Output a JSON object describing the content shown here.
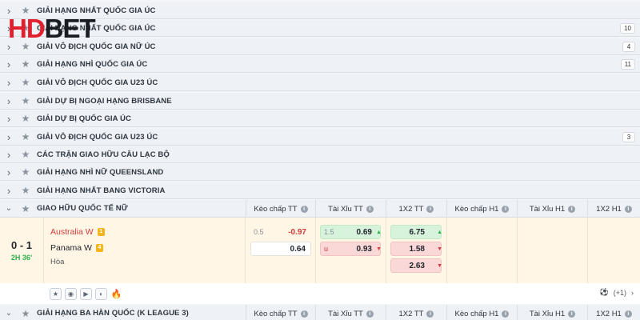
{
  "logo": {
    "part1": "HD",
    "part2": "BET"
  },
  "leagues": [
    {
      "name": "GIẢI HẠNG NHẤT QUỐC GIA ÚC",
      "count": ""
    },
    {
      "name": "GIẢI HẠNG NHẤT QUỐC GIA ÚC",
      "count": "10"
    },
    {
      "name": "GIẢI VÔ ĐỊCH QUỐC GIA NỮ ÚC",
      "count": "4"
    },
    {
      "name": "GIẢI HẠNG NHÌ QUỐC GIA ÚC",
      "count": "11"
    },
    {
      "name": "GIẢI VÔ ĐỊCH QUỐC GIA U23 ÚC",
      "count": ""
    },
    {
      "name": "GIẢI DỰ BỊ NGOẠI HẠNG BRISBANE",
      "count": ""
    },
    {
      "name": "GIẢI DỰ BỊ QUỐC GIA ÚC",
      "count": ""
    },
    {
      "name": "GIẢI VÔ ĐỊCH QUỐC GIA U23 ÚC",
      "count": "3"
    },
    {
      "name": "CÁC TRẬN GIAO HỮU CÂU LẠC BỘ",
      "count": ""
    },
    {
      "name": "GIẢI HẠNG NHÌ NỮ QUEENSLAND",
      "count": ""
    },
    {
      "name": "GIẢI HẠNG NHẤT BANG VICTORIA",
      "count": ""
    }
  ],
  "active_league": {
    "name": "GIAO HỮU QUỐC TẾ NỮ"
  },
  "columns": [
    "Kèo chấp TT",
    "Tài Xỉu TT",
    "1X2 TT",
    "Kèo chấp H1",
    "Tài Xỉu H1",
    "1X2 H1"
  ],
  "match": {
    "score": "0 - 1",
    "time": "2H 36'",
    "home": "Australia W",
    "home_card": "1",
    "away": "Panama W",
    "away_card": "4",
    "draw": "Hòa",
    "handicap": {
      "line": "0.5",
      "home": "-0.97",
      "away": "0.64"
    },
    "over_under": {
      "line": "1.5",
      "over": "0.69",
      "under_label": "u",
      "under": "0.93"
    },
    "x12": {
      "home": "6.75",
      "away": "1.58",
      "draw": "2.63"
    },
    "more_label": "(+1)"
  },
  "bottom_league": {
    "name": "GIẢI HẠNG BA HÀN QUỐC (K LEAGUE 3)"
  },
  "icons": {
    "chevron": "chevron-right-icon",
    "star": "star-icon",
    "info": "info-icon"
  }
}
